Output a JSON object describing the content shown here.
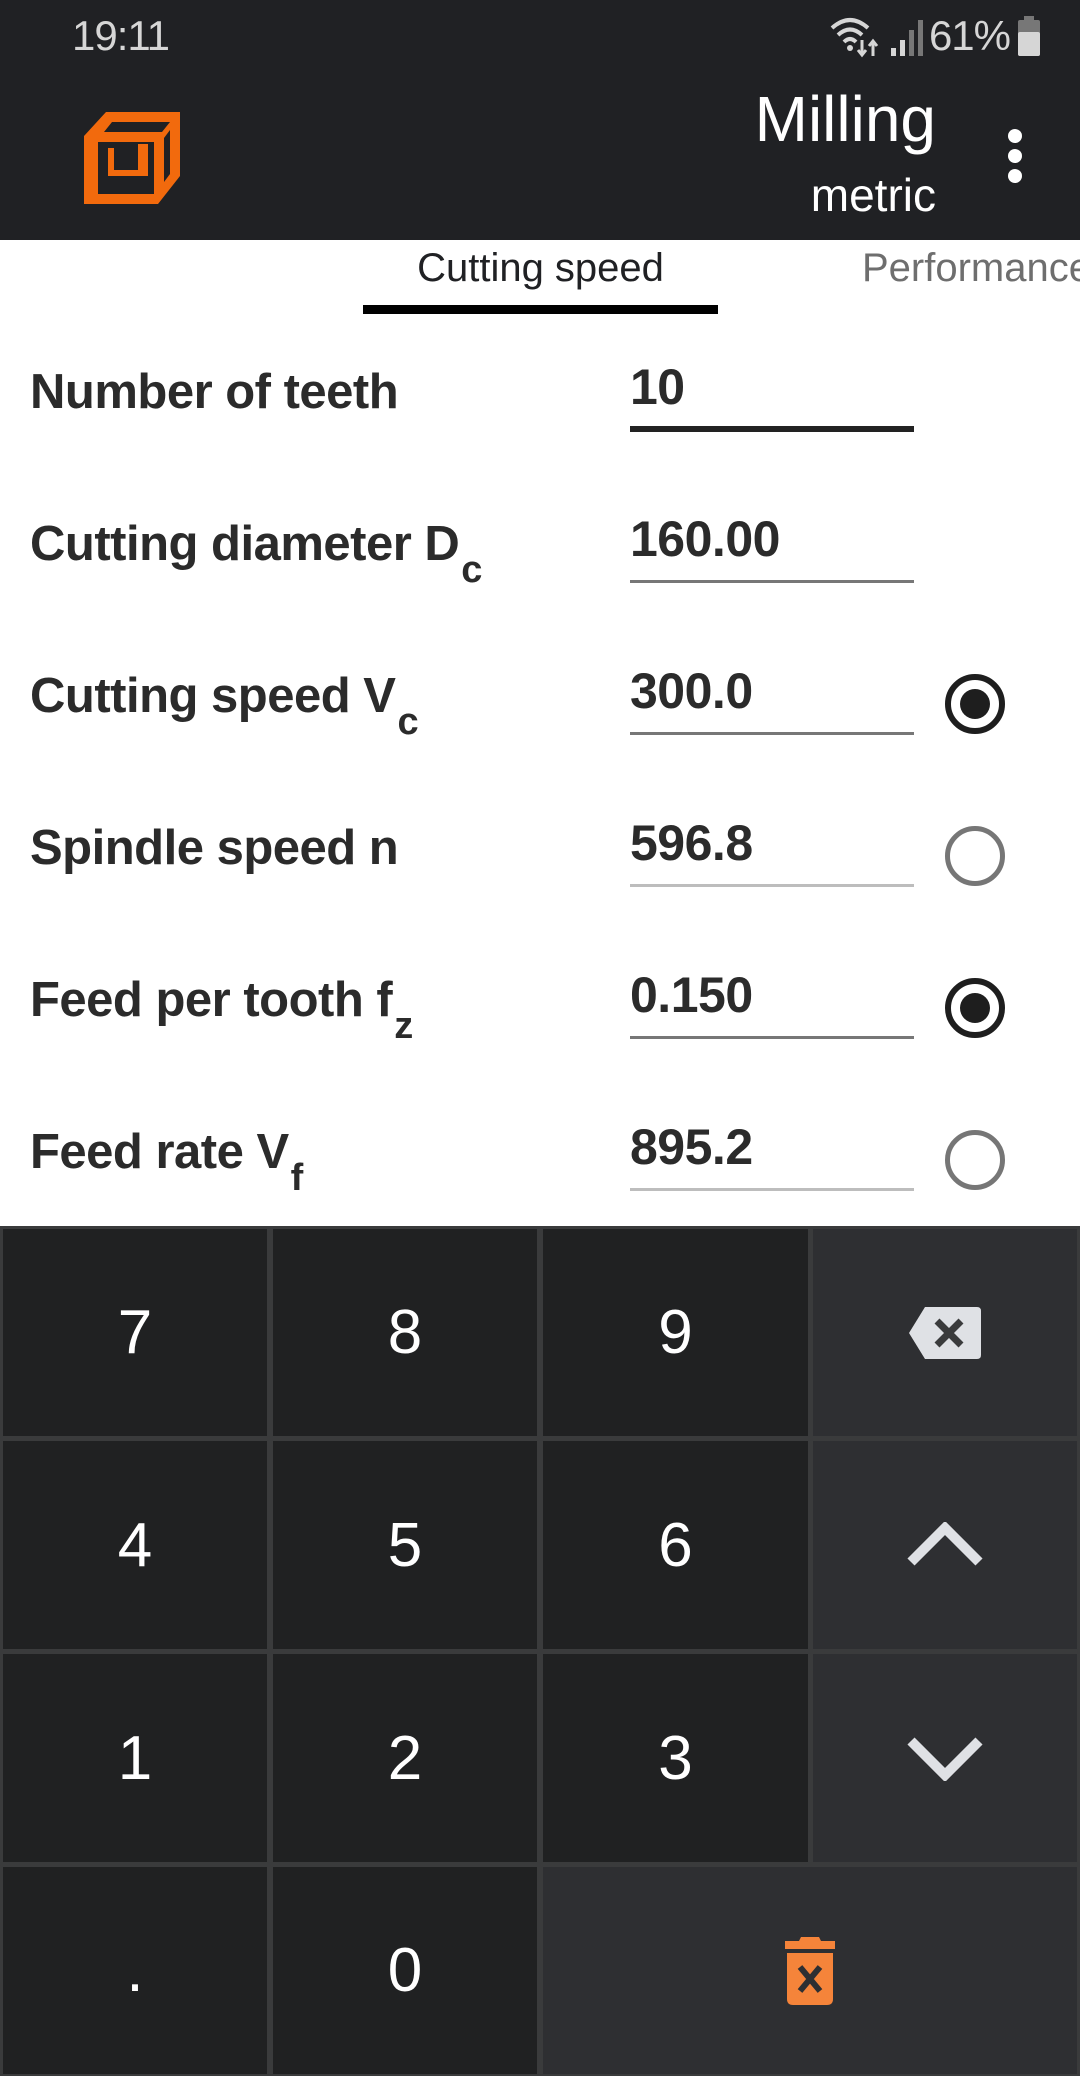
{
  "status_bar": {
    "time": "19:11",
    "battery_percent": "61%",
    "icons": [
      "wifi-data-icon",
      "signal-icon",
      "battery-icon"
    ]
  },
  "app_bar": {
    "logo_icon": "wireframe-cube-logo",
    "title": "Milling",
    "subtitle": "metric",
    "menu_icon": "more-vert-icon",
    "accent_color": "#f26a0d"
  },
  "tabs": [
    {
      "label": "Cutting speed",
      "active": true
    },
    {
      "label": "Performance",
      "active": false
    }
  ],
  "form": {
    "rows": [
      {
        "label": "Number of teeth",
        "subscript": "",
        "value": "10",
        "focused": true,
        "radio": null
      },
      {
        "label": "Cutting diameter D",
        "subscript": "c",
        "value": "160.00",
        "focused": false,
        "radio": null
      },
      {
        "label": "Cutting speed V",
        "subscript": "c",
        "value": "300.0",
        "focused": false,
        "radio": "selected"
      },
      {
        "label": "Spindle speed n",
        "subscript": "",
        "value": "596.8",
        "focused": false,
        "radio": "unselected"
      },
      {
        "label": "Feed per tooth f",
        "subscript": "z",
        "value": "0.150",
        "focused": false,
        "radio": "selected"
      },
      {
        "label": "Feed rate V",
        "subscript": "f",
        "value": "895.2",
        "focused": false,
        "radio": "unselected"
      }
    ]
  },
  "keypad": {
    "keys": {
      "k7": "7",
      "k8": "8",
      "k9": "9",
      "k4": "4",
      "k5": "5",
      "k6": "6",
      "k1": "1",
      "k2": "2",
      "k3": "3",
      "kdot": ".",
      "k0": "0"
    },
    "function_keys": {
      "backspace": "backspace-icon",
      "up": "chevron-up-icon",
      "down": "chevron-down-icon",
      "clear": "delete-forever-icon"
    },
    "clear_color": "#f5843a"
  }
}
